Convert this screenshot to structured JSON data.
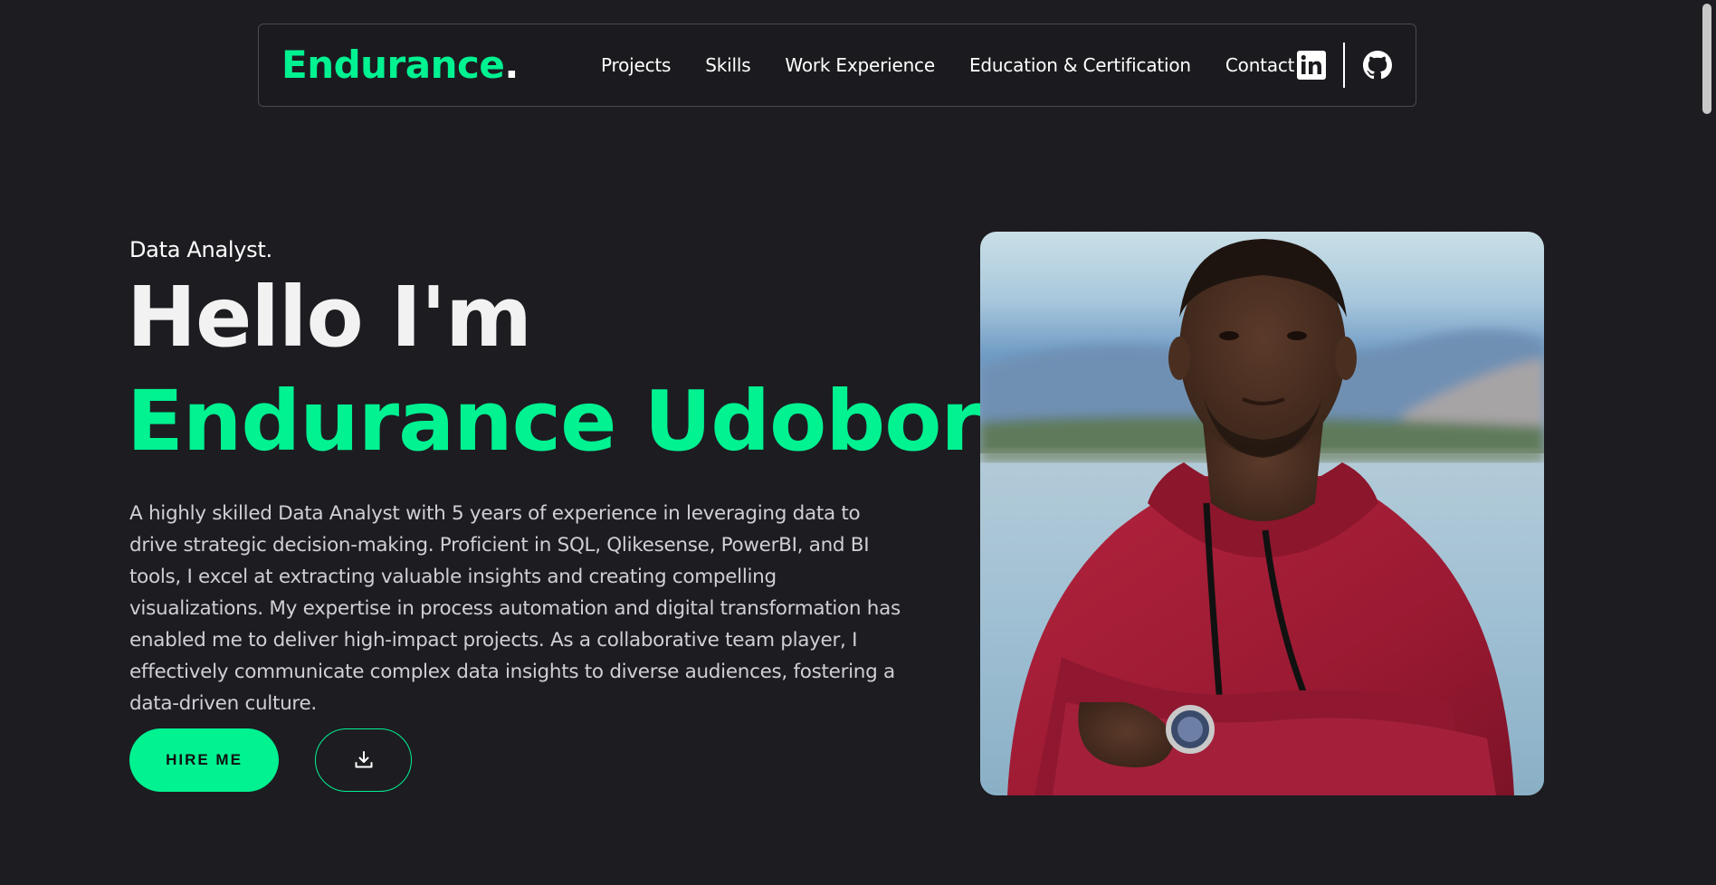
{
  "nav": {
    "brand": "Endurance",
    "brand_dot": ".",
    "links": [
      "Projects",
      "Skills",
      "Work Experience",
      "Education & Certification",
      "Contact"
    ],
    "social_icons": [
      "linkedin-icon",
      "github-icon"
    ]
  },
  "hero": {
    "kicker": "Data Analyst.",
    "greeting": "Hello I'm",
    "name": "Endurance Udobor",
    "bio": "A highly skilled Data Analyst with 5 years of experience in leveraging data to drive strategic decision-making. Proficient in SQL, Qlikesense, PowerBI, and BI tools, I excel at extracting valuable insights and creating compelling visualizations. My expertise in process automation and digital transformation has enabled me to deliver high-impact projects. As a collaborative team player, I effectively communicate complex data insights to diverse audiences, fostering a data-driven culture.",
    "hire_label": "HIRE ME",
    "download_icon": "download-icon"
  },
  "colors": {
    "accent": "#00f291",
    "background": "#1d1c21",
    "text": "#ffffff",
    "muted_text": "#cfcfd4",
    "hoodie": "#a01c34"
  }
}
